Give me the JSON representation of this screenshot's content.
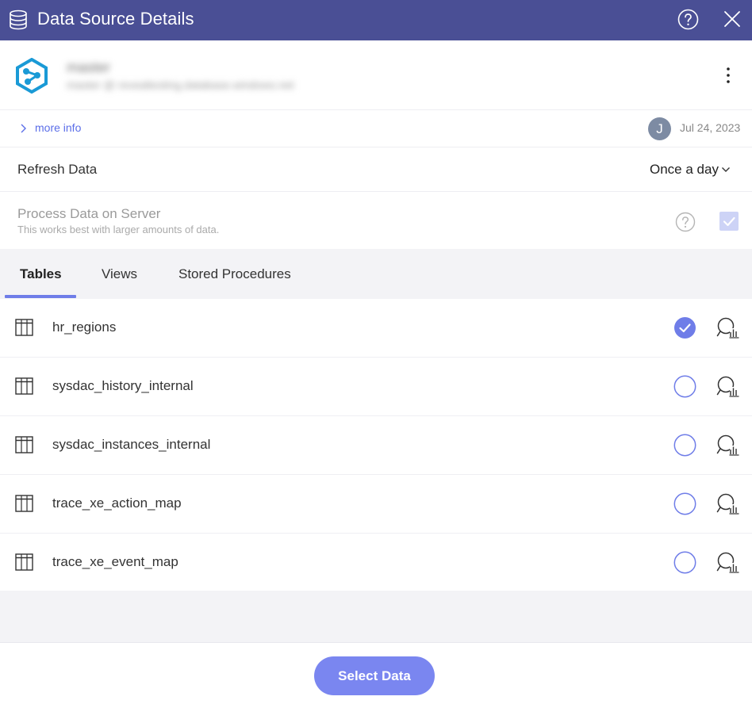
{
  "header": {
    "title": "Data Source Details"
  },
  "source": {
    "name": "master",
    "subtitle": "master @ revealtesting.database.windows.net"
  },
  "more_info": {
    "link_label": "more info",
    "avatar_initial": "J",
    "date": "Jul 24, 2023"
  },
  "refresh": {
    "label": "Refresh Data",
    "value": "Once a day"
  },
  "process": {
    "label": "Process Data on Server",
    "description": "This works best with larger amounts of data.",
    "checked": true
  },
  "tabs": [
    {
      "label": "Tables",
      "active": true
    },
    {
      "label": "Views",
      "active": false
    },
    {
      "label": "Stored Procedures",
      "active": false
    }
  ],
  "tables": [
    {
      "name": "hr_regions",
      "selected": true
    },
    {
      "name": "sysdac_history_internal",
      "selected": false
    },
    {
      "name": "sysdac_instances_internal",
      "selected": false
    },
    {
      "name": "trace_xe_action_map",
      "selected": false
    },
    {
      "name": "trace_xe_event_map",
      "selected": false
    }
  ],
  "footer": {
    "button_label": "Select Data"
  },
  "colors": {
    "header_bg": "#4a4f95",
    "accent": "#6f7de8",
    "button_bg": "#7a86f0",
    "logo": "#1a9ad6"
  }
}
